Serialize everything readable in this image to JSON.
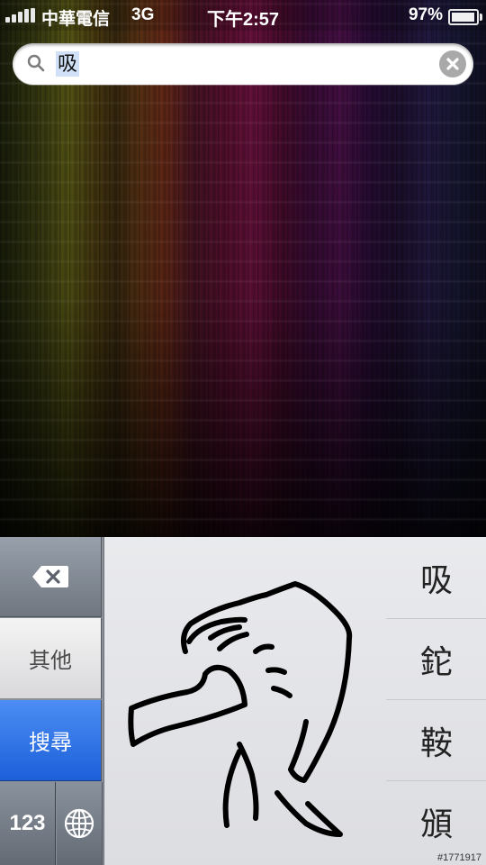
{
  "status_bar": {
    "carrier": "中華電信",
    "network": "3G",
    "time": "下午2:57",
    "battery_percent": "97%",
    "battery_level": 0.97
  },
  "search": {
    "query": "吸",
    "icon": "search-icon",
    "clear_icon": "clear-icon"
  },
  "keyboard": {
    "delete_icon": "backspace-icon",
    "other_label": "其他",
    "search_label": "搜尋",
    "numbers_label": "123",
    "globe_icon": "globe-icon",
    "candidates": [
      "吸",
      "鉈",
      "鞍",
      "頒"
    ]
  },
  "colors": {
    "search_key": "#2a6fe6",
    "selection": "#cfe0f7"
  },
  "watermark": "#1771917"
}
